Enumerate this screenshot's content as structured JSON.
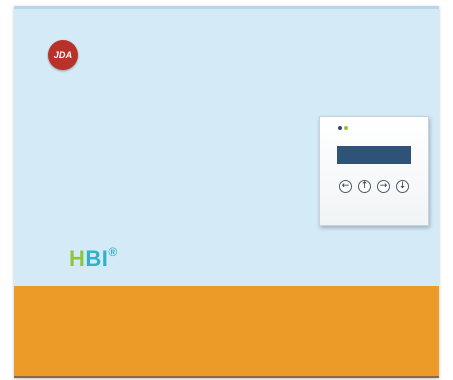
{
  "brand": {
    "logo_text": "JDA",
    "product_letter_h": "H",
    "product_letters_bi": "BI",
    "registered_mark": "®"
  },
  "device": {
    "led_colors": [
      "#2d4a7a",
      "#9bc32a"
    ],
    "screen_color": "#2f5278",
    "buttons": [
      {
        "name": "left-arrow-button",
        "glyph": "←"
      },
      {
        "name": "up-arrow-button",
        "glyph": "↑"
      },
      {
        "name": "right-arrow-button",
        "glyph": "→"
      },
      {
        "name": "down-arrow-button",
        "glyph": "↓"
      }
    ]
  },
  "colors": {
    "background": "#d4ebf7",
    "accent_orange": "#ec9a28",
    "logo_red": "#b8322a",
    "brand_green": "#8cc63f",
    "brand_cyan": "#2eb1c9"
  }
}
